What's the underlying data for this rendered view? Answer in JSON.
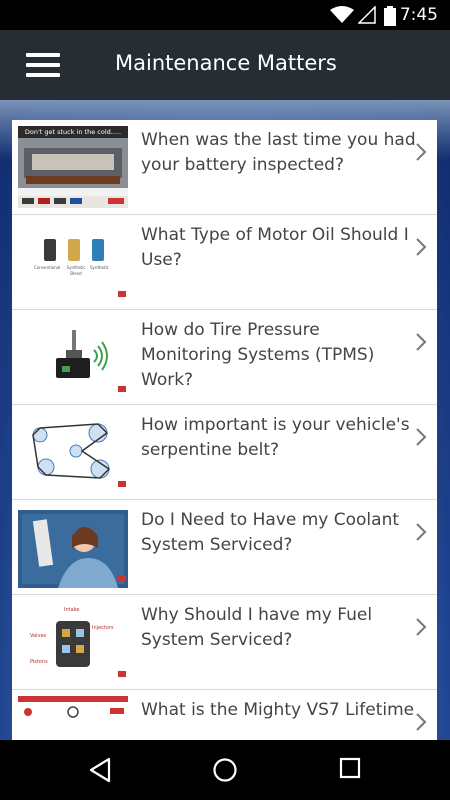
{
  "status": {
    "time": "7:45"
  },
  "app": {
    "title": "Maintenance Matters"
  },
  "items": [
    {
      "title": "When was the last time you had your battery inspected?",
      "thumb_caption": "Don't get stuck in the cold....."
    },
    {
      "title": "What Type of Motor Oil Should I Use?",
      "thumb_labels": [
        "Conventional",
        "Synthetic Blend",
        "Synthetic"
      ]
    },
    {
      "title": "How do Tire Pressure Monitoring Systems (TPMS) Work?"
    },
    {
      "title": "How important is your vehicle's serpentine belt?"
    },
    {
      "title": "Do I Need to Have my Coolant System Serviced?"
    },
    {
      "title": "Why Should I have my Fuel System Serviced?",
      "thumb_labels": [
        "Intake",
        "Injectors",
        "Valves",
        "Pistons"
      ]
    },
    {
      "title": "What is the Mighty VS7 Lifetime"
    }
  ],
  "colors": {
    "app_bar": "#262d33",
    "list_text": "#444444"
  },
  "icons": {
    "menu": "hamburger-icon",
    "chevron": "chevron-right-icon",
    "back": "back-icon",
    "home": "home-icon",
    "recents": "recents-icon"
  }
}
